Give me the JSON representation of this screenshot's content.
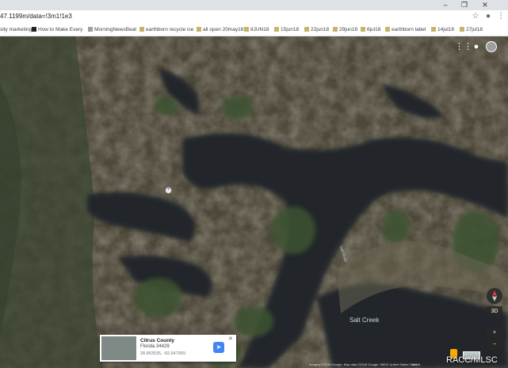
{
  "browser": {
    "url": "47.1199m/data=!3m1!1e3",
    "window_controls": [
      "–",
      "❐",
      "✕"
    ]
  },
  "bookmarks": [
    {
      "label": "sity marketing",
      "icon": "none"
    },
    {
      "label": "How to Make Every",
      "icon": "youtube-icon"
    },
    {
      "label": "MorningNewsBeat",
      "icon": "page-icon"
    },
    {
      "label": "earthborn recycle ice",
      "icon": "folder-icon"
    },
    {
      "label": "all open 20may18",
      "icon": "folder-icon"
    },
    {
      "label": "8JUN18",
      "icon": "folder-icon"
    },
    {
      "label": "15jun18",
      "icon": "folder-icon"
    },
    {
      "label": "22jun18",
      "icon": "folder-icon"
    },
    {
      "label": "29jun18",
      "icon": "folder-icon"
    },
    {
      "label": "6jul18",
      "icon": "folder-icon"
    },
    {
      "label": "earthborn label",
      "icon": "folder-icon"
    },
    {
      "label": "14jul18",
      "icon": "folder-icon"
    },
    {
      "label": "27jul18",
      "icon": "folder-icon"
    }
  ],
  "map": {
    "labels": {
      "creek": "Salt Creek",
      "river": "Salt River"
    },
    "info_card": {
      "title": "Citrus County",
      "subtitle": "Florida 34429",
      "coords": "28.863535, -82.647959",
      "directions_icon": "directions-icon",
      "close": "✕"
    },
    "controls": {
      "zoom_in": "+",
      "zoom_out": "−",
      "view_3d": "3D"
    },
    "footer": "Imagery ©2018 Google, Map data ©2018 Google, INEGI   United States   Terms",
    "scale": "500 ft"
  },
  "watermark": "RACC/MLSC",
  "colors": {
    "marsh": "#4a4538",
    "water": "#23262a",
    "trees": "#3f5030",
    "accent": "#4285f4"
  }
}
